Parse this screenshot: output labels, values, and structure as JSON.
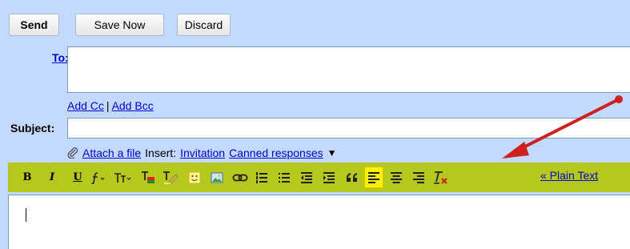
{
  "toolbar_buttons": {
    "send_label": "Send",
    "save_label": "Save Now",
    "discard_label": "Discard"
  },
  "to": {
    "label": "To:",
    "value": ""
  },
  "recipients": {
    "add_cc": "Add Cc",
    "separator": "|",
    "add_bcc": "Add Bcc"
  },
  "subject": {
    "label": "Subject:",
    "value": ""
  },
  "attach": {
    "attach_link": "Attach a file",
    "insert_label": "Insert:",
    "invitation_link": "Invitation",
    "canned_link": "Canned responses",
    "canned_arrow": "▼"
  },
  "formatting": {
    "bold": "B",
    "italic": "I",
    "underline": "U",
    "plain_text_link": "« Plain Text",
    "toolbar_color": "#b4c81e",
    "highlight_color": "#fff200",
    "icons": [
      "bold-icon",
      "italic-icon",
      "underline-icon",
      "font-icon",
      "font-size-icon",
      "text-color-icon",
      "highlight-color-icon",
      "emoticon-icon",
      "image-icon",
      "link-icon",
      "numbered-list-icon",
      "bulleted-list-icon",
      "indent-less-icon",
      "indent-more-icon",
      "quote-icon",
      "align-left-icon",
      "align-center-icon",
      "align-right-icon",
      "remove-formatting-icon"
    ]
  },
  "editor": {
    "body": ""
  },
  "annotation": {
    "color": "#d01f1f"
  },
  "colors": {
    "compose_bg": "#c3d9ff",
    "link": "#0000cc",
    "field_border": "#7e9db9"
  }
}
